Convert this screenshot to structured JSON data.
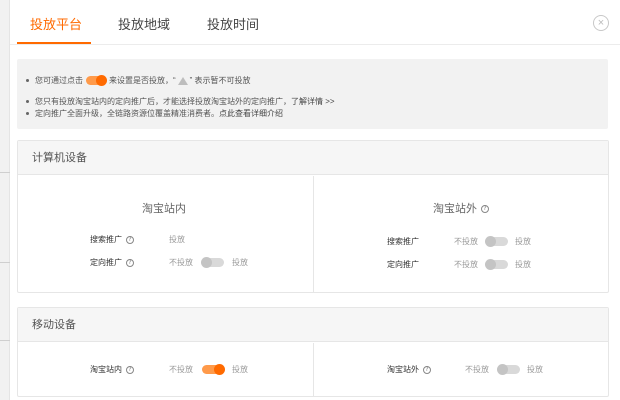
{
  "tabs": [
    {
      "label": "投放平台"
    },
    {
      "label": "投放地域"
    },
    {
      "label": "投放时间"
    }
  ],
  "close": {
    "glyph": "×"
  },
  "notice": {
    "line1_before": "您可通过点击",
    "line1_after": "来设置是否投放，",
    "line1_quote_open": "“",
    "line1_quote_close": "” 表示暂不可投放",
    "line2_text": "您只有投放淘宝站内的定向推广后，才能选择投放淘宝站外的定向推广，",
    "line2_link": "了解详情 >>",
    "line3_text": "定向推广全面升级，全链路资源位覆盖精准消费者。",
    "line3_link": "点此查看详细介绍"
  },
  "computer": {
    "title": "计算机设备",
    "inside": {
      "title": "淘宝站内",
      "search_label": "搜索推广",
      "search_value": "投放",
      "target_label": "定向推广",
      "off_label": "不投放",
      "on_label": "投放",
      "target_on": false
    },
    "outside": {
      "title": "淘宝站外",
      "search_label": "搜索推广",
      "target_label": "定向推广",
      "off_label": "不投放",
      "on_label": "投放",
      "search_on": false,
      "target_on": false
    }
  },
  "mobile": {
    "title": "移动设备",
    "inside_label": "淘宝站内",
    "outside_label": "淘宝站外",
    "off_label": "不投放",
    "on_label": "投放",
    "inside_on": true,
    "outside_on": false
  },
  "q_glyph": "?",
  "colors": {
    "accent": "#ff6a00",
    "switch_on_track": "#ff9a4a",
    "switch_off": "#c4c4c4"
  }
}
